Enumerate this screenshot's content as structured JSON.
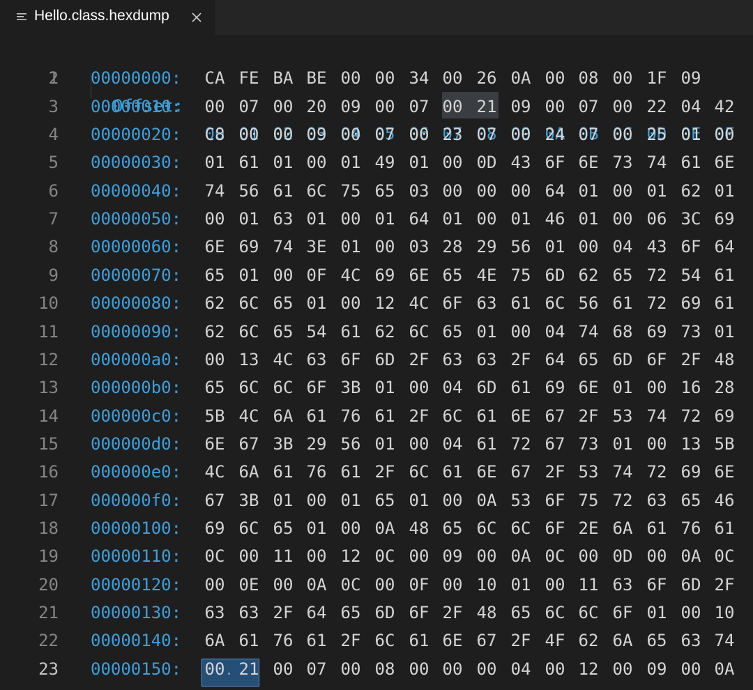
{
  "tab": {
    "title": "Hello.class.hexdump",
    "icon": "file-lines-icon",
    "close_icon": "close-icon"
  },
  "editor": {
    "header": {
      "line_number": "1",
      "label": "Offset:",
      "columns": [
        "00",
        "01",
        "02",
        "03",
        "04",
        "05",
        "06",
        "07",
        "08",
        "09",
        "0A",
        "0B",
        "0C",
        "0D",
        "0E",
        "0F"
      ]
    },
    "active_line": "23",
    "rows": [
      {
        "ln": "2",
        "offset": "00000000:",
        "bytes": [
          "CA",
          "FE",
          "BA",
          "BE",
          "00",
          "00",
          "34",
          "00",
          "26",
          "0A",
          "00",
          "08",
          "00",
          "1F",
          "09"
        ]
      },
      {
        "ln": "3",
        "offset": "00000010:",
        "bytes": [
          "00",
          "07",
          "00",
          "20",
          "09",
          "00",
          "07",
          "00",
          "21",
          "09",
          "00",
          "07",
          "00",
          "22",
          "04",
          "42"
        ]
      },
      {
        "ln": "4",
        "offset": "00000020:",
        "bytes": [
          "C8",
          "00",
          "00",
          "09",
          "00",
          "07",
          "00",
          "23",
          "07",
          "00",
          "24",
          "07",
          "00",
          "25",
          "01",
          "00"
        ]
      },
      {
        "ln": "5",
        "offset": "00000030:",
        "bytes": [
          "01",
          "61",
          "01",
          "00",
          "01",
          "49",
          "01",
          "00",
          "0D",
          "43",
          "6F",
          "6E",
          "73",
          "74",
          "61",
          "6E"
        ]
      },
      {
        "ln": "6",
        "offset": "00000040:",
        "bytes": [
          "74",
          "56",
          "61",
          "6C",
          "75",
          "65",
          "03",
          "00",
          "00",
          "00",
          "64",
          "01",
          "00",
          "01",
          "62",
          "01"
        ]
      },
      {
        "ln": "7",
        "offset": "00000050:",
        "bytes": [
          "00",
          "01",
          "63",
          "01",
          "00",
          "01",
          "64",
          "01",
          "00",
          "01",
          "46",
          "01",
          "00",
          "06",
          "3C",
          "69"
        ]
      },
      {
        "ln": "8",
        "offset": "00000060:",
        "bytes": [
          "6E",
          "69",
          "74",
          "3E",
          "01",
          "00",
          "03",
          "28",
          "29",
          "56",
          "01",
          "00",
          "04",
          "43",
          "6F",
          "64"
        ]
      },
      {
        "ln": "9",
        "offset": "00000070:",
        "bytes": [
          "65",
          "01",
          "00",
          "0F",
          "4C",
          "69",
          "6E",
          "65",
          "4E",
          "75",
          "6D",
          "62",
          "65",
          "72",
          "54",
          "61"
        ]
      },
      {
        "ln": "10",
        "offset": "00000080:",
        "bytes": [
          "62",
          "6C",
          "65",
          "01",
          "00",
          "12",
          "4C",
          "6F",
          "63",
          "61",
          "6C",
          "56",
          "61",
          "72",
          "69",
          "61"
        ]
      },
      {
        "ln": "11",
        "offset": "00000090:",
        "bytes": [
          "62",
          "6C",
          "65",
          "54",
          "61",
          "62",
          "6C",
          "65",
          "01",
          "00",
          "04",
          "74",
          "68",
          "69",
          "73",
          "01"
        ]
      },
      {
        "ln": "12",
        "offset": "000000a0:",
        "bytes": [
          "00",
          "13",
          "4C",
          "63",
          "6F",
          "6D",
          "2F",
          "63",
          "63",
          "2F",
          "64",
          "65",
          "6D",
          "6F",
          "2F",
          "48"
        ]
      },
      {
        "ln": "13",
        "offset": "000000b0:",
        "bytes": [
          "65",
          "6C",
          "6C",
          "6F",
          "3B",
          "01",
          "00",
          "04",
          "6D",
          "61",
          "69",
          "6E",
          "01",
          "00",
          "16",
          "28"
        ]
      },
      {
        "ln": "14",
        "offset": "000000c0:",
        "bytes": [
          "5B",
          "4C",
          "6A",
          "61",
          "76",
          "61",
          "2F",
          "6C",
          "61",
          "6E",
          "67",
          "2F",
          "53",
          "74",
          "72",
          "69"
        ]
      },
      {
        "ln": "15",
        "offset": "000000d0:",
        "bytes": [
          "6E",
          "67",
          "3B",
          "29",
          "56",
          "01",
          "00",
          "04",
          "61",
          "72",
          "67",
          "73",
          "01",
          "00",
          "13",
          "5B"
        ]
      },
      {
        "ln": "16",
        "offset": "000000e0:",
        "bytes": [
          "4C",
          "6A",
          "61",
          "76",
          "61",
          "2F",
          "6C",
          "61",
          "6E",
          "67",
          "2F",
          "53",
          "74",
          "72",
          "69",
          "6E"
        ]
      },
      {
        "ln": "17",
        "offset": "000000f0:",
        "bytes": [
          "67",
          "3B",
          "01",
          "00",
          "01",
          "65",
          "01",
          "00",
          "0A",
          "53",
          "6F",
          "75",
          "72",
          "63",
          "65",
          "46"
        ]
      },
      {
        "ln": "18",
        "offset": "00000100:",
        "bytes": [
          "69",
          "6C",
          "65",
          "01",
          "00",
          "0A",
          "48",
          "65",
          "6C",
          "6C",
          "6F",
          "2E",
          "6A",
          "61",
          "76",
          "61"
        ]
      },
      {
        "ln": "19",
        "offset": "00000110:",
        "bytes": [
          "0C",
          "00",
          "11",
          "00",
          "12",
          "0C",
          "00",
          "09",
          "00",
          "0A",
          "0C",
          "00",
          "0D",
          "00",
          "0A",
          "0C"
        ]
      },
      {
        "ln": "20",
        "offset": "00000120:",
        "bytes": [
          "00",
          "0E",
          "00",
          "0A",
          "0C",
          "00",
          "0F",
          "00",
          "10",
          "01",
          "00",
          "11",
          "63",
          "6F",
          "6D",
          "2F"
        ]
      },
      {
        "ln": "21",
        "offset": "00000130:",
        "bytes": [
          "63",
          "63",
          "2F",
          "64",
          "65",
          "6D",
          "6F",
          "2F",
          "48",
          "65",
          "6C",
          "6C",
          "6F",
          "01",
          "00",
          "10"
        ]
      },
      {
        "ln": "22",
        "offset": "00000140:",
        "bytes": [
          "6A",
          "61",
          "76",
          "61",
          "2F",
          "6C",
          "61",
          "6E",
          "67",
          "2F",
          "4F",
          "62",
          "6A",
          "65",
          "63",
          "74"
        ]
      },
      {
        "ln": "23",
        "offset": "00000150:",
        "bytes": [
          "00",
          "21",
          "00",
          "07",
          "00",
          "08",
          "00",
          "00",
          "00",
          "04",
          "00",
          "12",
          "00",
          "09",
          "00",
          "0A"
        ]
      }
    ]
  },
  "colors": {
    "background": "#1e1e1e",
    "offset_blue": "#3e9fdb",
    "text": "#d4d4d4",
    "line_number": "#858585",
    "selection": "#264f78"
  }
}
